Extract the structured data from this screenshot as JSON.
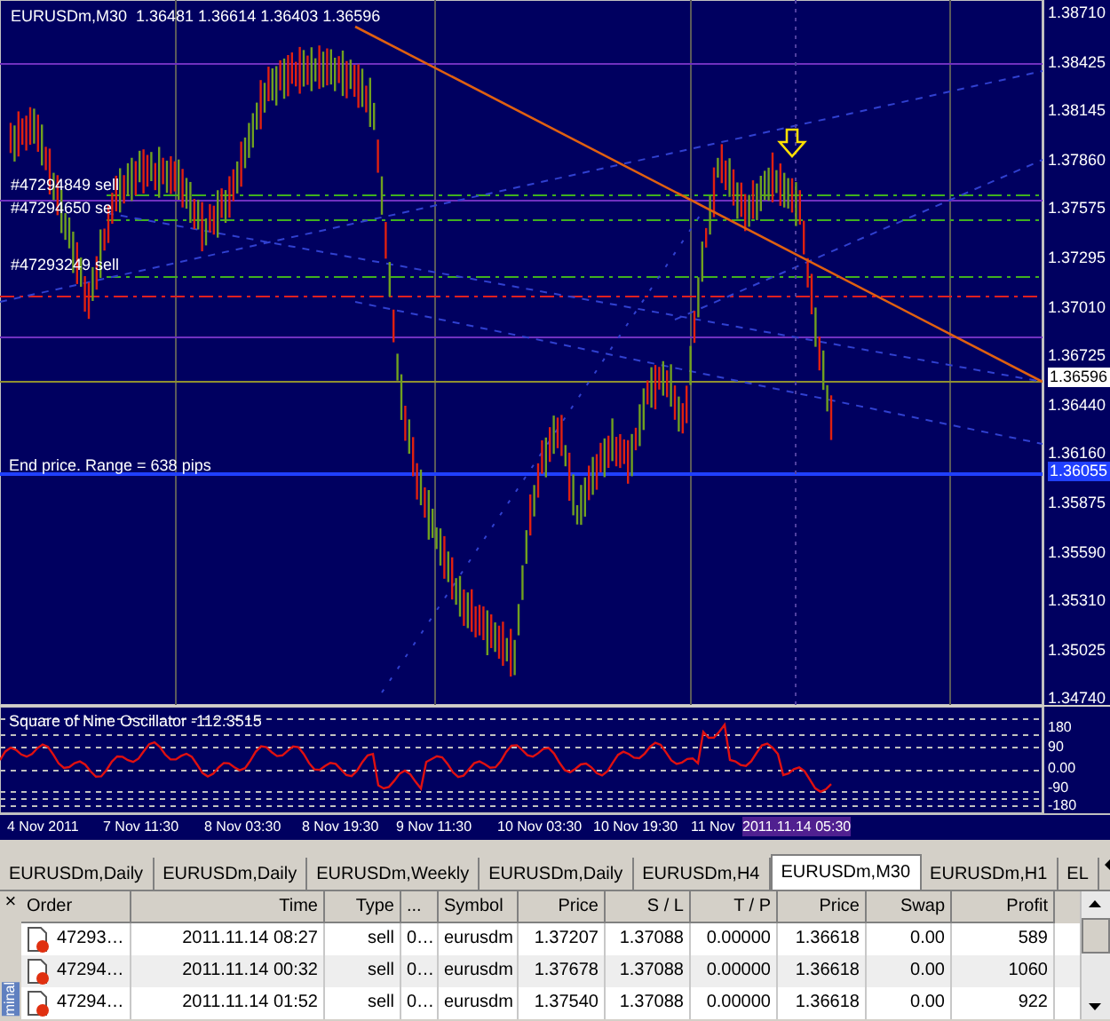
{
  "chart": {
    "symbol": "EURUSDm,M30",
    "ohlc": "1.36481 1.36614 1.36403 1.36596",
    "order_labels": [
      "#47294849 sell",
      "#47294650 se",
      "#47293249 sell"
    ],
    "range_label": "End price. Range = 638 pips",
    "price_axis": [
      "1.38710",
      "1.38425",
      "1.38145",
      "1.37860",
      "1.37575",
      "1.37295",
      "1.37010",
      "1.36725",
      "1.36440",
      "1.36160",
      "1.35875",
      "1.35590",
      "1.35310",
      "1.35025",
      "1.34740"
    ],
    "current_price": "1.36596",
    "line_price": "1.36055"
  },
  "oscillator": {
    "title": "Square of Nine Oscillator -112.3515",
    "axis": [
      "180",
      "90",
      "0.00",
      "-90",
      "-180"
    ]
  },
  "time_axis": [
    "4 Nov 2011",
    "7 Nov 11:30",
    "8 Nov 03:30",
    "8 Nov 19:30",
    "9 Nov 11:30",
    "10 Nov 03:30",
    "10 Nov 19:30",
    "11 Nov"
  ],
  "cursor_time": "2011.11.14 05:30",
  "tabs": [
    {
      "label": "EURUSDm,Daily",
      "selected": false
    },
    {
      "label": "EURUSDm,Daily",
      "selected": false
    },
    {
      "label": "EURUSDm,Weekly",
      "selected": false
    },
    {
      "label": "EURUSDm,Daily",
      "selected": false
    },
    {
      "label": "EURUSDm,H4",
      "selected": false
    },
    {
      "label": "EURUSDm,M30",
      "selected": true
    },
    {
      "label": "EURUSDm,H1",
      "selected": false
    },
    {
      "label": "EL",
      "selected": false
    }
  ],
  "terminal": {
    "side_label": "minal",
    "close": "×",
    "columns": [
      "Order",
      "Time",
      "Type",
      "...",
      "Symbol",
      "Price",
      "S / L",
      "T / P",
      "Price",
      "Swap",
      "Profit"
    ],
    "rows": [
      [
        "47293…",
        "2011.11.14 08:27",
        "sell",
        "0…",
        "eurusdm",
        "1.37207",
        "1.37088",
        "0.00000",
        "1.36618",
        "0.00",
        "589"
      ],
      [
        "47294…",
        "2011.11.14 00:32",
        "sell",
        "0…",
        "eurusdm",
        "1.37678",
        "1.37088",
        "0.00000",
        "1.36618",
        "0.00",
        "1060"
      ],
      [
        "47294…",
        "2011.11.14 01:52",
        "sell",
        "0…",
        "eurusdm",
        "1.37540",
        "1.37088",
        "0.00000",
        "1.36618",
        "0.00",
        "922"
      ]
    ]
  }
}
